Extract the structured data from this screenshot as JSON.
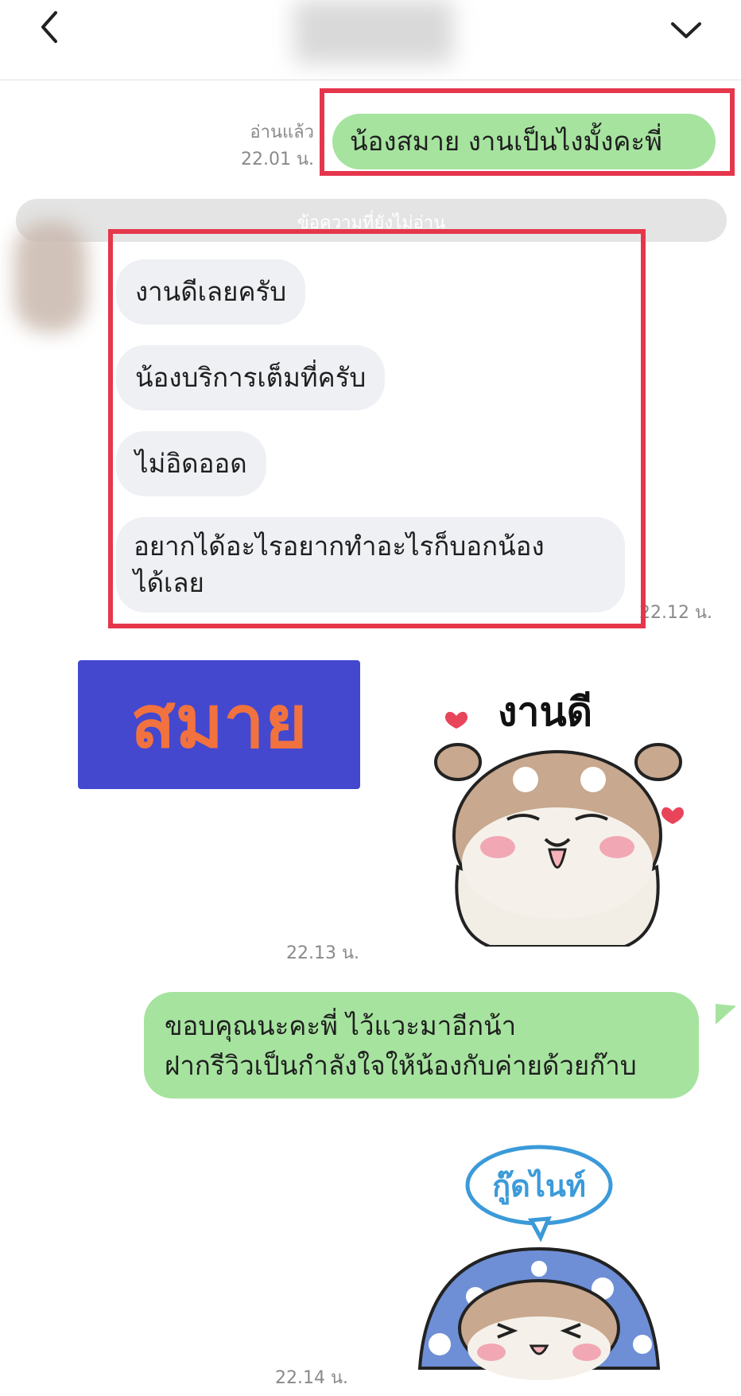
{
  "header": {
    "back_icon": "chevron-left-icon",
    "menu_icon": "chevron-down-icon"
  },
  "messages": {
    "m1": {
      "status": "อ่านแล้ว",
      "time": "22.01 น.",
      "text": "น้องสมาย งานเป็นไงมั้งคะพี่"
    },
    "unread_divider": "ข้อความที่ยังไม่อ่าน",
    "reply": [
      "งานดีเลยครับ",
      "น้องบริการเต็มที่ครับ",
      "ไม่อิดออด",
      "อยากได้อะไรอยากทำอะไรก็บอกน้อง\nได้เลย"
    ],
    "reply_time": "22.12 น.",
    "sticker1_time": "22.13 น.",
    "m2": {
      "text": "ขอบคุณนะคะพี่ ไว้แวะมาอีกน้า\nฝากรีวิวเป็นกำลังใจให้น้องกับค่ายด้วยก๊าบ"
    },
    "sticker2_time": "22.14 น."
  },
  "overlay": {
    "name_label": "สมาย"
  },
  "stickers": {
    "s1_caption": "งานดี",
    "s2_caption": "กู๊ดไนท์"
  },
  "colors": {
    "my_bubble": "#a6e39f",
    "their_bubble": "#eef0f3",
    "highlight": "#e5364c",
    "label_bg": "#4348cf",
    "label_text": "#f1723e"
  }
}
